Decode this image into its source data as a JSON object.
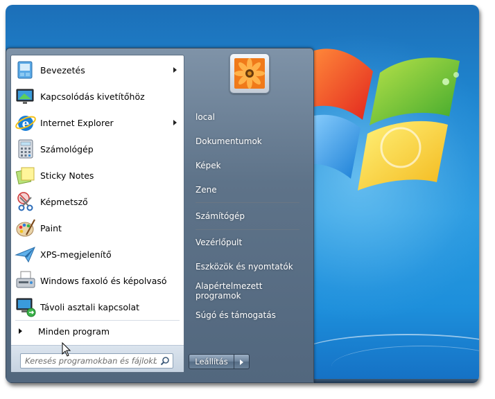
{
  "programs": [
    {
      "label": "Bevezetés",
      "icon": "getting-started-icon",
      "submenu": true
    },
    {
      "label": "Kapcsolódás kivetítőhöz",
      "icon": "projector-icon",
      "submenu": false
    },
    {
      "label": "Internet Explorer",
      "icon": "internet-explorer-icon",
      "submenu": true
    },
    {
      "label": "Számológép",
      "icon": "calculator-icon",
      "submenu": false
    },
    {
      "label": "Sticky Notes",
      "icon": "sticky-notes-icon",
      "submenu": false
    },
    {
      "label": "Képmetsző",
      "icon": "snipping-tool-icon",
      "submenu": false
    },
    {
      "label": "Paint",
      "icon": "paint-icon",
      "submenu": false
    },
    {
      "label": "XPS-megjelenítő",
      "icon": "xps-viewer-icon",
      "submenu": false
    },
    {
      "label": "Windows faxoló és képolvasó",
      "icon": "fax-scan-icon",
      "submenu": false
    },
    {
      "label": "Távoli asztali kapcsolat",
      "icon": "remote-desktop-icon",
      "submenu": false
    }
  ],
  "all_programs": "Minden program",
  "search": {
    "placeholder": "Keresés programokban és fájlokban"
  },
  "right_links": [
    {
      "label": "local"
    },
    {
      "label": "Dokumentumok"
    },
    {
      "label": "Képek"
    },
    {
      "label": "Zene"
    },
    {
      "label": "Számítógép"
    },
    {
      "label": "Vezérlőpult"
    },
    {
      "label": "Eszközök és nyomtatók"
    },
    {
      "label": "Alapértelmezett programok"
    },
    {
      "label": "Súgó és támogatás"
    }
  ],
  "shutdown": {
    "label": "Leállítás"
  },
  "colors": {
    "desktop": "#1f86d0",
    "menu_glass": "#5e7389",
    "left_pane": "#ffffff"
  }
}
